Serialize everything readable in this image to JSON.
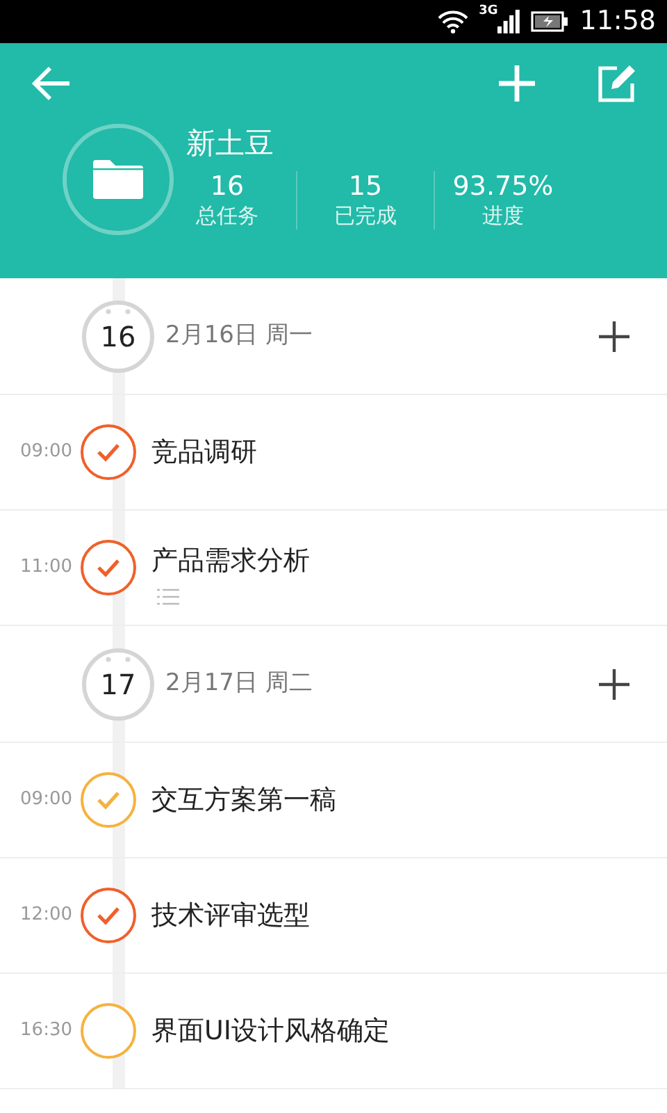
{
  "status_bar": {
    "network": "3G",
    "time": "11:58"
  },
  "project": {
    "title": "新土豆",
    "stats": [
      {
        "value": "16",
        "label": "总任务"
      },
      {
        "value": "15",
        "label": "已完成"
      },
      {
        "value": "93.75%",
        "label": "进度"
      }
    ]
  },
  "days": [
    {
      "day": "16",
      "date": "2月16日 周一",
      "tasks": [
        {
          "time": "09:00",
          "title": "竞品调研",
          "checked": true,
          "color": "#f0602a",
          "has_notes": false
        },
        {
          "time": "11:00",
          "title": "产品需求分析",
          "checked": true,
          "color": "#f0602a",
          "has_notes": true
        }
      ]
    },
    {
      "day": "17",
      "date": "2月17日 周二",
      "tasks": [
        {
          "time": "09:00",
          "title": "交互方案第一稿",
          "checked": true,
          "color": "#f5b23f",
          "has_notes": false
        },
        {
          "time": "12:00",
          "title": "技术评审选型",
          "checked": true,
          "color": "#f0602a",
          "has_notes": false
        },
        {
          "time": "16:30",
          "title": "界面UI设计风格确定",
          "checked": false,
          "color": "#f5b23f",
          "has_notes": false
        }
      ]
    }
  ]
}
